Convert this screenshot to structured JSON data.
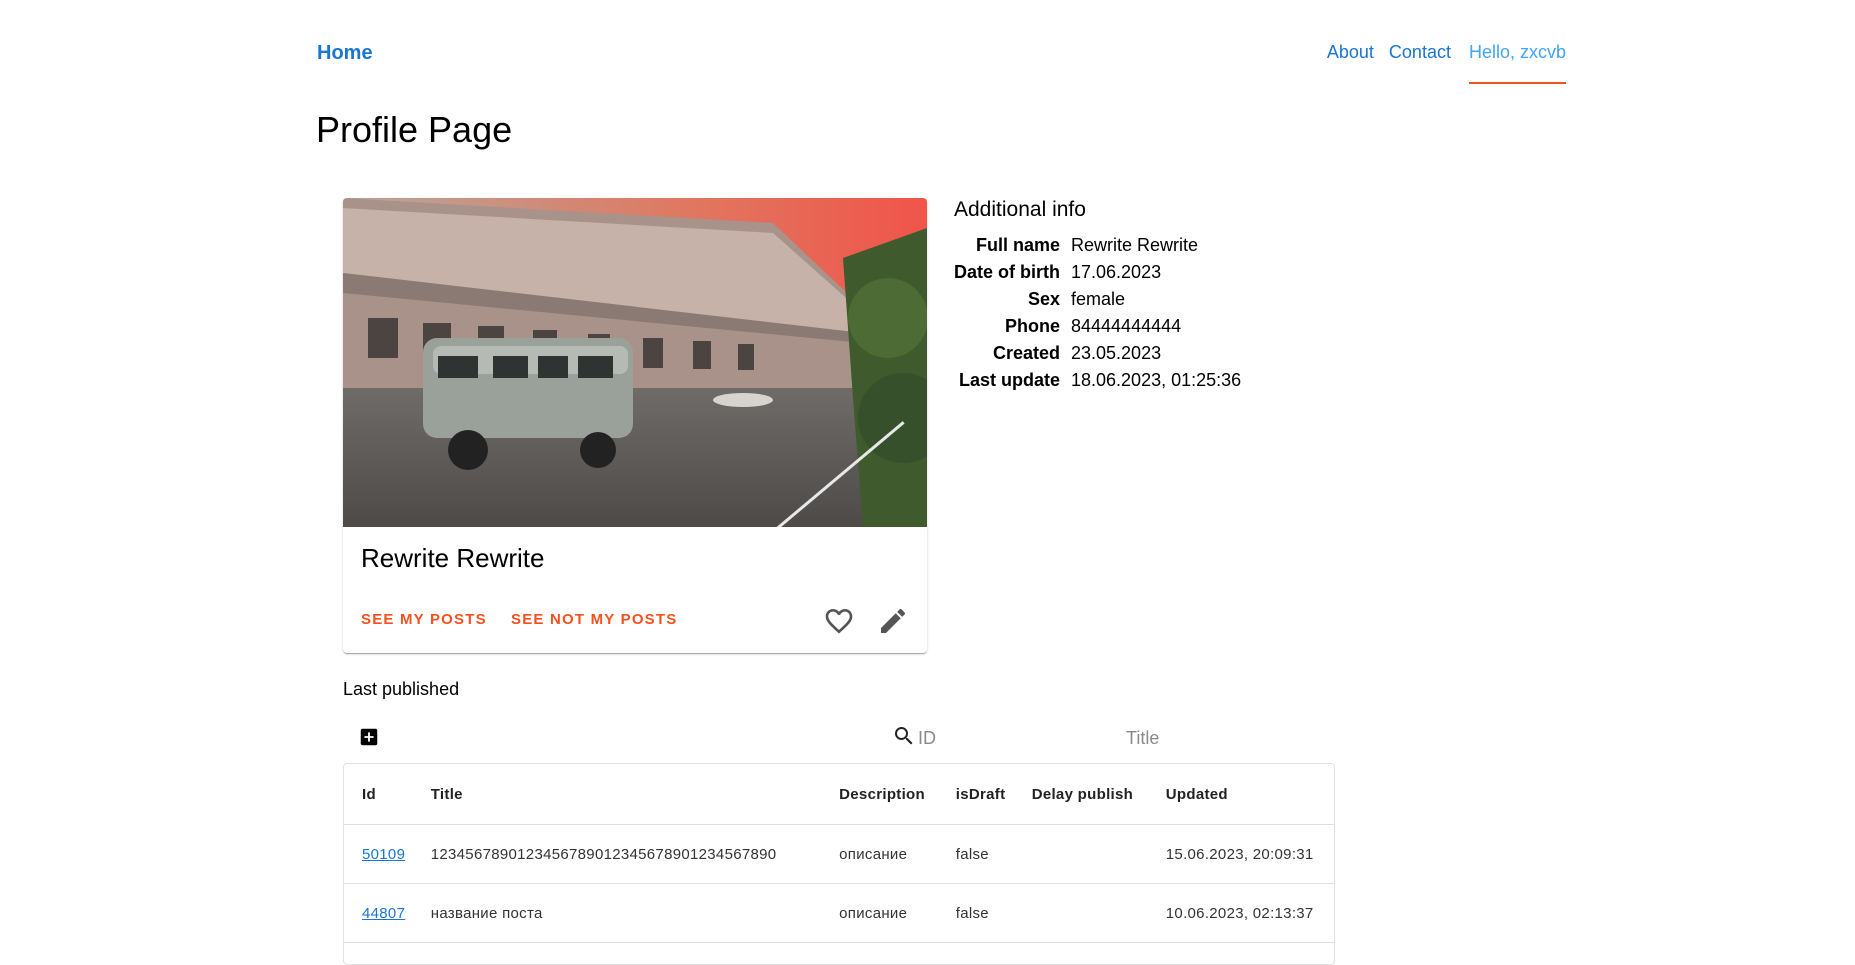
{
  "nav": {
    "home": "Home",
    "links": [
      "About",
      "Contact"
    ],
    "user": "Hello, zxcvb"
  },
  "page_title": "Profile Page",
  "card": {
    "name": "Rewrite Rewrite",
    "actions": [
      "SEE MY POSTS",
      "SEE NOT MY POSTS"
    ],
    "icons": [
      "heart-outline-icon",
      "pencil-edit-icon"
    ]
  },
  "info": {
    "title": "Additional info",
    "rows": [
      {
        "key": "Full name",
        "value": "Rewrite Rewrite"
      },
      {
        "key": "Date of birth",
        "value": "17.06.2023"
      },
      {
        "key": "Sex",
        "value": "female"
      },
      {
        "key": "Phone",
        "value": "84444444444"
      },
      {
        "key": "Created",
        "value": "23.05.2023"
      },
      {
        "key": "Last update",
        "value": "18.06.2023, 01:25:36"
      }
    ]
  },
  "posts": {
    "heading": "Last published",
    "filters": {
      "id_placeholder": "ID",
      "title_placeholder": "Title"
    },
    "columns": [
      "Id",
      "Title",
      "Description",
      "isDraft",
      "Delay publish",
      "Updated"
    ],
    "rows": [
      {
        "id": "50109",
        "title": "1234567890123456789012345678901234567890",
        "description": "описание",
        "isDraft": "false",
        "delay": "",
        "updated": "15.06.2023, 20:09:31"
      },
      {
        "id": "44807",
        "title": "название поста",
        "description": "описание",
        "isDraft": "false",
        "delay": "",
        "updated": "10.06.2023, 02:13:37"
      }
    ]
  },
  "colors": {
    "primary": "#1976d2",
    "accent": "#f4511e",
    "user_link": "#42a5f5"
  }
}
